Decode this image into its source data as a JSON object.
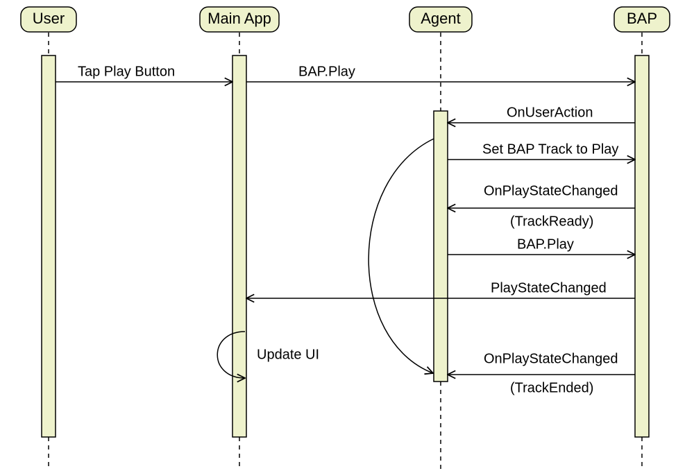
{
  "participants": {
    "user": "User",
    "mainapp": "Main App",
    "agent": "Agent",
    "bap": "BAP"
  },
  "messages": {
    "m1": "Tap Play Button",
    "m2": "BAP.Play",
    "m3": "OnUserAction",
    "m4": "Set BAP Track to Play",
    "m5a": "OnPlayStateChanged",
    "m5b": "(TrackReady)",
    "m6": "BAP.Play",
    "m7": "PlayStateChanged",
    "m8": "Update UI",
    "m9a": "OnPlayStateChanged",
    "m9b": "(TrackEnded)"
  },
  "colors": {
    "fill": "#EEF2CC",
    "stroke": "#000000"
  }
}
